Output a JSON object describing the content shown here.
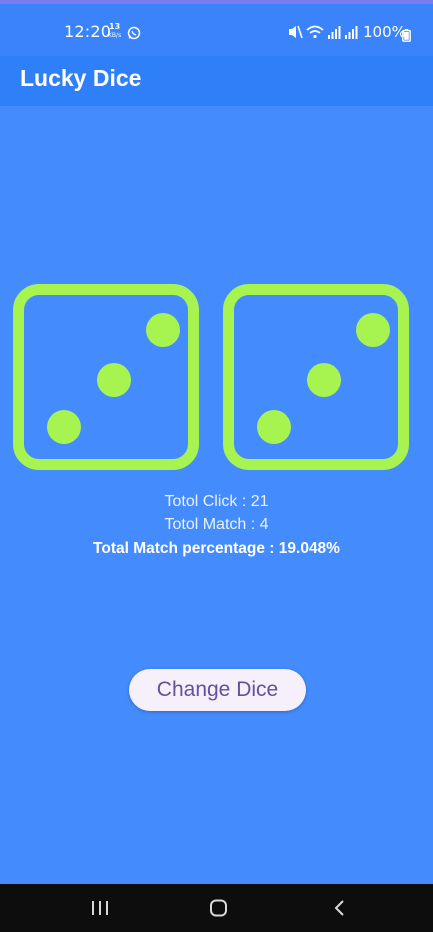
{
  "status_bar": {
    "time": "12:20",
    "net_speed_value": "13",
    "net_speed_unit": "KB/s",
    "battery_text": "100%",
    "icons": [
      "whatsapp-icon",
      "mute-icon",
      "wifi-icon",
      "signal-icon",
      "signal-icon",
      "battery-icon"
    ]
  },
  "app_bar": {
    "title": "Lucky Dice"
  },
  "dice": {
    "left_value": 3,
    "right_value": 3,
    "color": "#a7f450"
  },
  "stats": {
    "clicks": "Totol Click : 21",
    "matches": "Totol Match : 4",
    "percentage": "Total Match percentage : 19.048%"
  },
  "button": {
    "label": "Change Dice"
  },
  "nav_bar": {
    "icons": [
      "recents-icon",
      "home-icon",
      "back-icon"
    ]
  },
  "colors": {
    "background": "#448bfd",
    "app_bar": "#2f7ff9",
    "button_text": "#64519c"
  }
}
